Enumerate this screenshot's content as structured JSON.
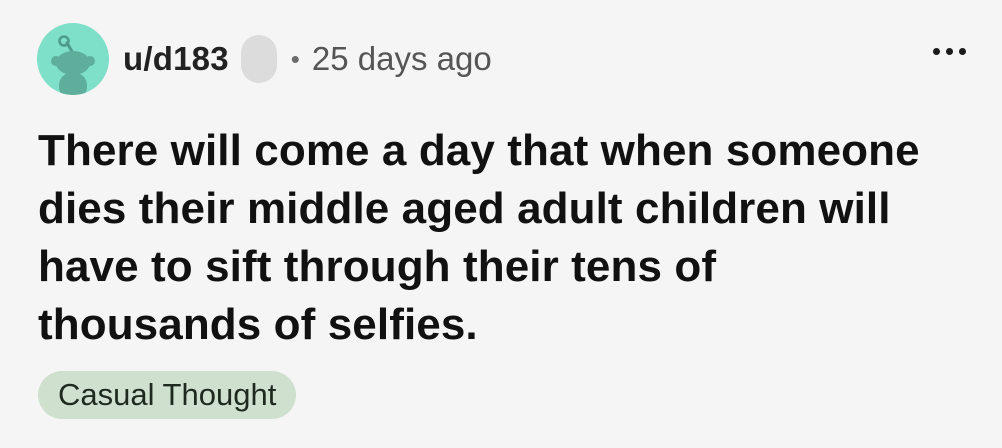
{
  "post": {
    "author": "u/d183",
    "separator": "•",
    "time": "25 days ago",
    "title": "There will come a day that when someone dies their middle aged adult children will have to sift through their tens of thousands of selfies.",
    "flair": "Casual Thought"
  },
  "icons": {
    "avatar": "snoo-avatar-icon",
    "more": "more-options-icon"
  },
  "colors": {
    "background": "#f5f5f5",
    "avatar_bg": "#7ee0c8",
    "flair_bg": "#cfe0cf",
    "text": "#111111",
    "meta_text": "#555555"
  }
}
